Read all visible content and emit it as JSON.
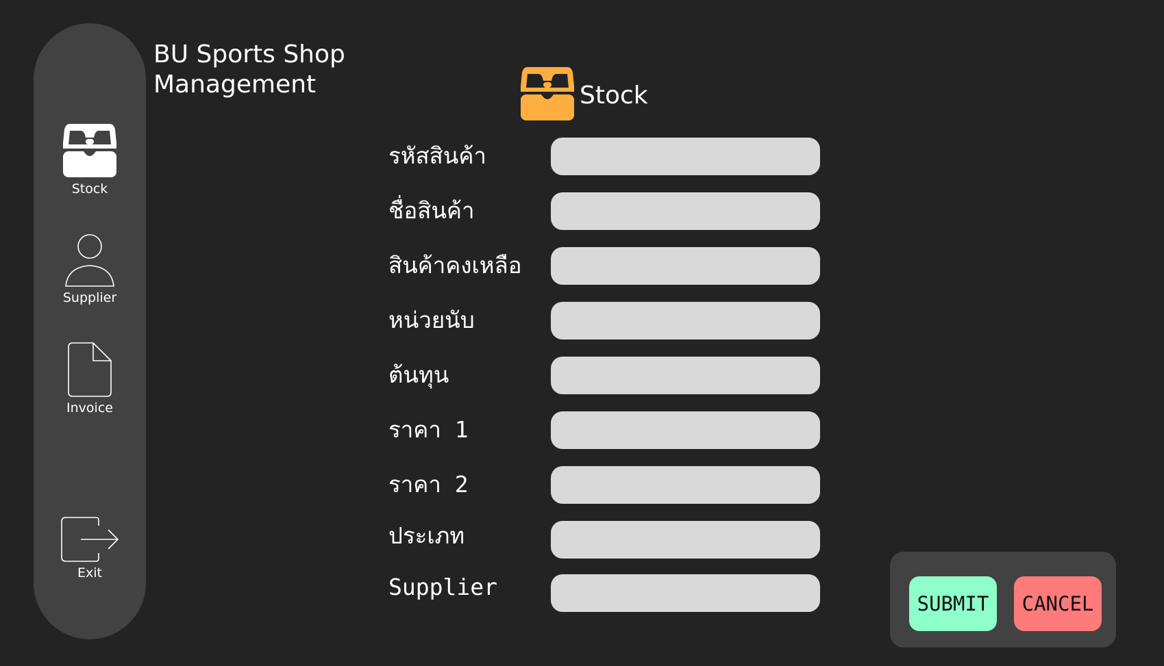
{
  "app": {
    "title": "BU Sports Shop Management"
  },
  "sidebar": {
    "items": [
      {
        "label": "Stock",
        "icon": "stock-drawer-icon"
      },
      {
        "label": "Supplier",
        "icon": "user-icon"
      },
      {
        "label": "Invoice",
        "icon": "document-icon"
      },
      {
        "label": "Exit",
        "icon": "exit-icon"
      }
    ]
  },
  "section": {
    "title": "Stock",
    "icon": "stock-drawer-icon"
  },
  "form": {
    "fields": [
      {
        "label": "รหัสสินค้า",
        "value": ""
      },
      {
        "label": "ชื่อสินค้า",
        "value": ""
      },
      {
        "label": "สินค้าคงเหลือ",
        "value": ""
      },
      {
        "label": "หน่วยนับ",
        "value": ""
      },
      {
        "label": "ต้นทุน",
        "value": ""
      },
      {
        "label": "ราคา 1",
        "value": ""
      },
      {
        "label": "ราคา 2",
        "value": ""
      },
      {
        "label": "ประเภท",
        "value": ""
      },
      {
        "label": "Supplier",
        "value": ""
      }
    ]
  },
  "actions": {
    "submit_label": "SUBMIT",
    "cancel_label": "CANCEL"
  },
  "colors": {
    "background": "#232323",
    "sidebar": "#424242",
    "accent": "#FDAE3E",
    "input": "#D9D9D9",
    "submit": "#8EFFCB",
    "cancel": "#FF7A7A"
  }
}
